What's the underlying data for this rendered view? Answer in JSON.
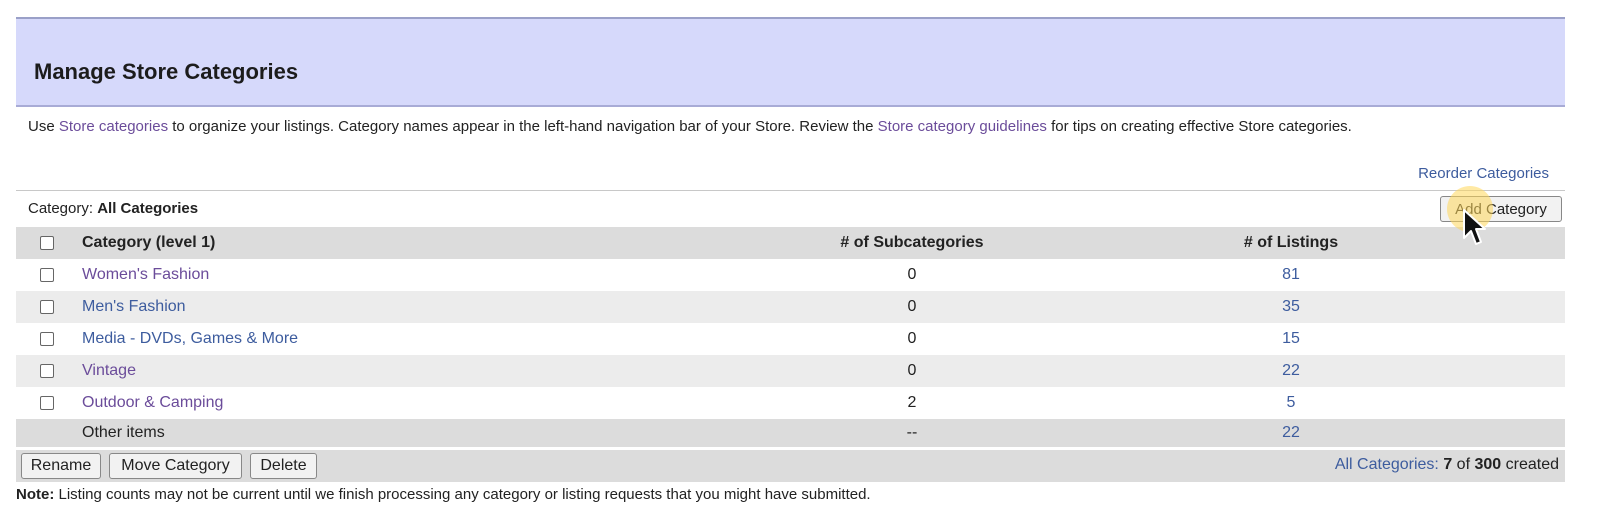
{
  "header": {
    "title": "Manage Store Categories"
  },
  "intro": {
    "text_before": "Use ",
    "link1": "Store categories",
    "text_middle": " to organize your listings. Category names appear in the left-hand navigation bar of your Store. Review the ",
    "link2": "Store category guidelines",
    "text_after": " for tips on creating effective Store categories."
  },
  "reorder_link": "Reorder Categories",
  "category_line": {
    "label": "Category:",
    "value": "All Categories"
  },
  "add_button": "Add Category",
  "table": {
    "headers": {
      "name": "Category (level 1)",
      "subcategories": "# of Subcategories",
      "listings": "# of Listings"
    },
    "rows": [
      {
        "name": "Women's Fashion",
        "subcategories": "0",
        "listings": "81"
      },
      {
        "name": "Men's Fashion",
        "subcategories": "0",
        "listings": "35"
      },
      {
        "name": "Media - DVDs, Games & More",
        "subcategories": "0",
        "listings": "15"
      },
      {
        "name": "Vintage",
        "subcategories": "0",
        "listings": "22"
      },
      {
        "name": "Outdoor & Camping",
        "subcategories": "2",
        "listings": "5"
      }
    ],
    "other_row": {
      "name": "Other items",
      "subcategories": "--",
      "listings": "22"
    }
  },
  "footer": {
    "rename": "Rename",
    "move": "Move Category",
    "delete": "Delete",
    "summary_link": "All Categories:",
    "count": "7",
    "of": "of",
    "max": "300",
    "created": "created"
  },
  "note": {
    "label": "Note:",
    "text": "Listing counts may not be current until we finish processing any category or listing requests that you might have submitted."
  },
  "colors": {
    "header_band": "#d6d9fb",
    "link_blue": "#3d5c9e",
    "link_purple": "#6b4c9a",
    "row_gray": "#dcdcdc"
  }
}
